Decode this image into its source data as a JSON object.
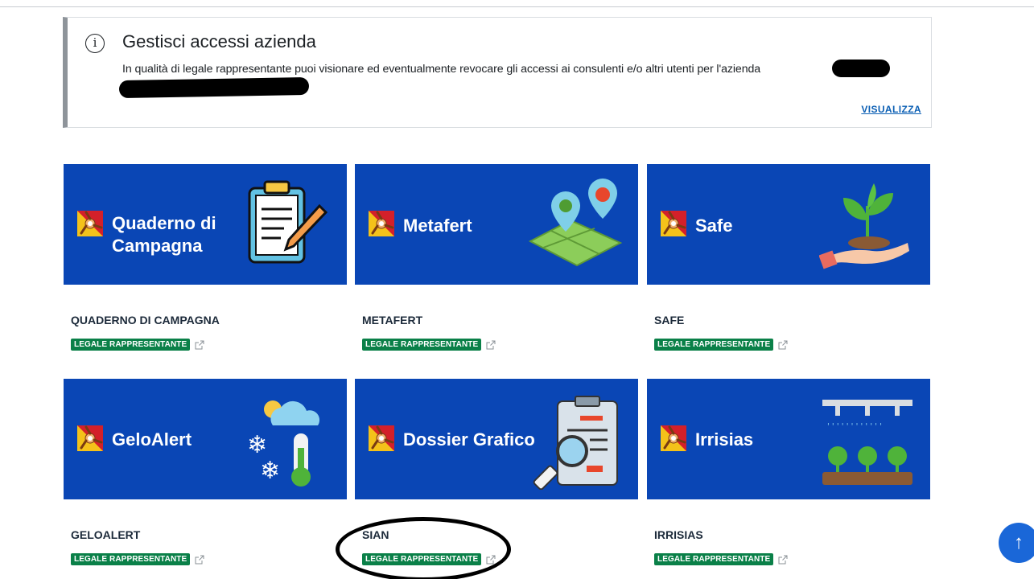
{
  "notice": {
    "title": "Gestisci accessi azienda",
    "text": "In qualità di legale rappresentante puoi visionare ed eventualmente revocare gli accessi ai consulenti e/o altri utenti per l'azienda",
    "link": "VISUALIZZA",
    "icon": "info-icon"
  },
  "apps": [
    {
      "tile_line1": "Quaderno di",
      "tile_line2": "Campagna",
      "title": "QUADERNO DI CAMPAGNA",
      "badge": "LEGALE RAPPRESENTANTE"
    },
    {
      "tile_line1": "Metafert",
      "tile_line2": "",
      "title": "METAFERT",
      "badge": "LEGALE RAPPRESENTANTE"
    },
    {
      "tile_line1": "Safe",
      "tile_line2": "",
      "title": "SAFE",
      "badge": "LEGALE RAPPRESENTANTE"
    },
    {
      "tile_line1": "GeloAlert",
      "tile_line2": "",
      "title": "GELOALERT",
      "badge": "LEGALE RAPPRESENTANTE"
    },
    {
      "tile_line1": "Dossier Grafico",
      "tile_line2": "",
      "title": "SIAN",
      "badge": "LEGALE RAPPRESENTANTE"
    },
    {
      "tile_line1": "Irrisias",
      "tile_line2": "",
      "title": "IRRISIAS",
      "badge": "LEGALE RAPPRESENTANTE"
    }
  ],
  "colors": {
    "tile": "#0a46b5",
    "badge": "#0a8048",
    "link": "#0b5fb4"
  },
  "back_to_top": "↑"
}
